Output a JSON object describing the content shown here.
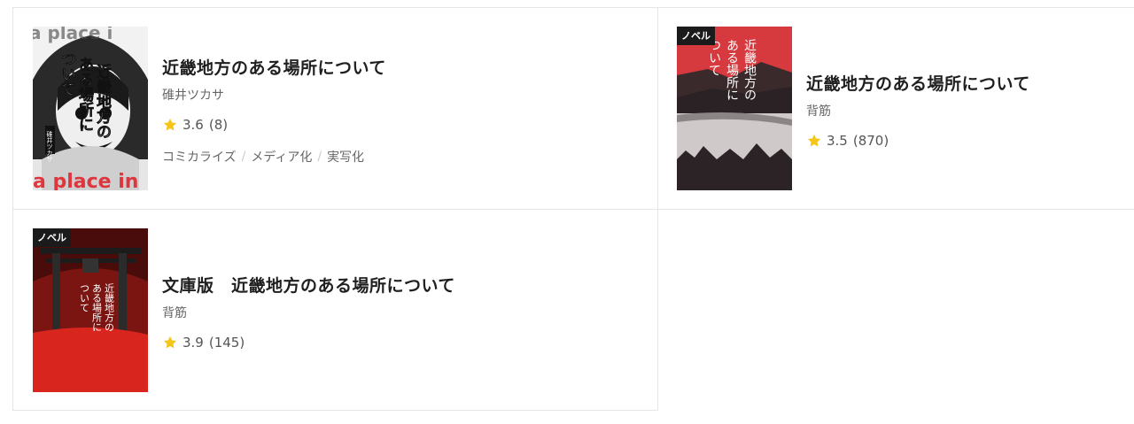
{
  "items": [
    {
      "title": "近畿地方のある場所について",
      "author": "碓井ツカサ",
      "rating": "3.6",
      "reviews": "(8)",
      "tags": [
        "コミカライズ",
        "メディア化",
        "実写化"
      ],
      "cover_badge": "",
      "cover_text": "近畿地方のある場所について",
      "cover_author_text": "碓井ツカサ"
    },
    {
      "title": "近畿地方のある場所について",
      "author": "背筋",
      "rating": "3.5",
      "reviews": "(870)",
      "tags": [],
      "cover_badge": "ノベル",
      "cover_text": "近畿地方のある場所について"
    },
    {
      "title": "文庫版　近畿地方のある場所について",
      "author": "背筋",
      "rating": "3.9",
      "reviews": "(145)",
      "tags": [],
      "cover_badge": "ノベル",
      "cover_text": "近畿地方のある場所について"
    }
  ],
  "colors": {
    "star": "#f5c518",
    "border": "#e6e6e6",
    "cover2_red": "#d63a3f",
    "cover3_red": "#d8261f"
  },
  "icons": {
    "rating": "star-icon"
  }
}
